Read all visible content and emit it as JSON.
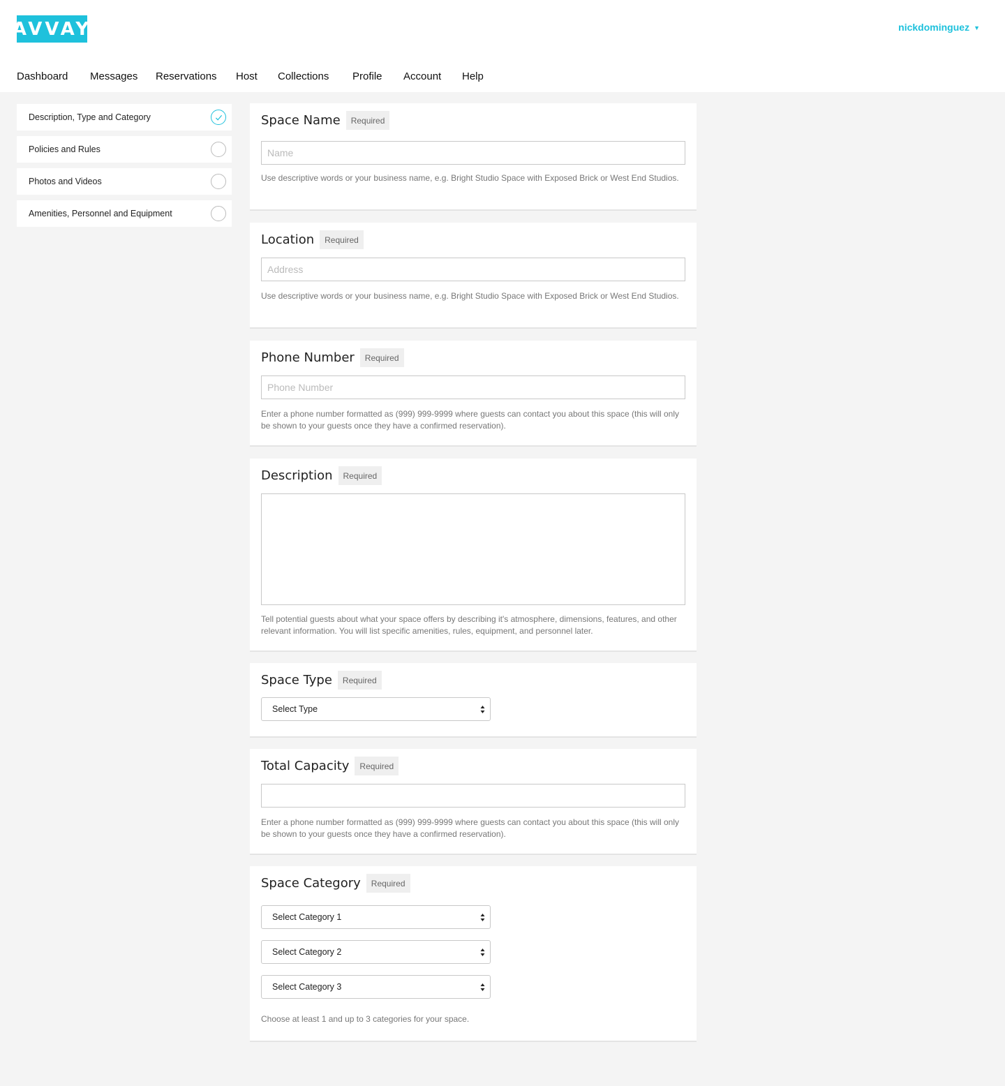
{
  "header": {
    "logo": "AVVAY",
    "username": "nickdominguez",
    "caret_icon": "chevron-down-icon"
  },
  "nav": {
    "items": [
      "Dashboard",
      "Messages",
      "Reservations",
      "Host",
      "Collections",
      "Profile",
      "Account",
      "Help"
    ]
  },
  "sidebar": {
    "items": [
      {
        "label": "Description, Type and Category",
        "complete": true
      },
      {
        "label": "Policies and Rules",
        "complete": false
      },
      {
        "label": "Photos and Videos",
        "complete": false
      },
      {
        "label": "Amenities, Personnel and Equipment",
        "complete": false
      }
    ]
  },
  "required_label": "Required",
  "sections": {
    "space_name": {
      "title": "Space Name",
      "placeholder": "Name",
      "value": "",
      "help": "Use descriptive words or your business name, e.g. Bright Studio Space with Exposed Brick or West End Studios."
    },
    "location": {
      "title": "Location",
      "placeholder": "Address",
      "value": "",
      "help": "Use descriptive words or your business name, e.g. Bright Studio Space with Exposed Brick or West End Studios."
    },
    "phone": {
      "title": "Phone Number",
      "placeholder": "Phone Number",
      "value": "",
      "help": "Enter a phone number formatted as (999) 999-9999 where guests can contact you about this space (this will only be shown to your guests once they have a confirmed reservation)."
    },
    "description": {
      "title": "Description",
      "value": "",
      "help": "Tell potential guests about what your space offers by describing it's atmosphere, dimensions, features, and other relevant information. You will list specific amenities, rules, equipment, and personnel later."
    },
    "space_type": {
      "title": "Space Type",
      "select": "Select Type"
    },
    "capacity": {
      "title": "Total Capacity",
      "value": "",
      "help": "Enter a phone number formatted as (999) 999-9999 where guests can contact you about this space (this will only be shown to your guests once they have a confirmed reservation)."
    },
    "category": {
      "title": "Space Category",
      "selects": [
        "Select Category 1",
        "Select Category 2",
        "Select Category 3"
      ],
      "help": "Choose at least 1 and up to 3 categories for your space."
    }
  },
  "colors": {
    "accent": "#1ec1dc",
    "background": "#f4f4f4"
  }
}
